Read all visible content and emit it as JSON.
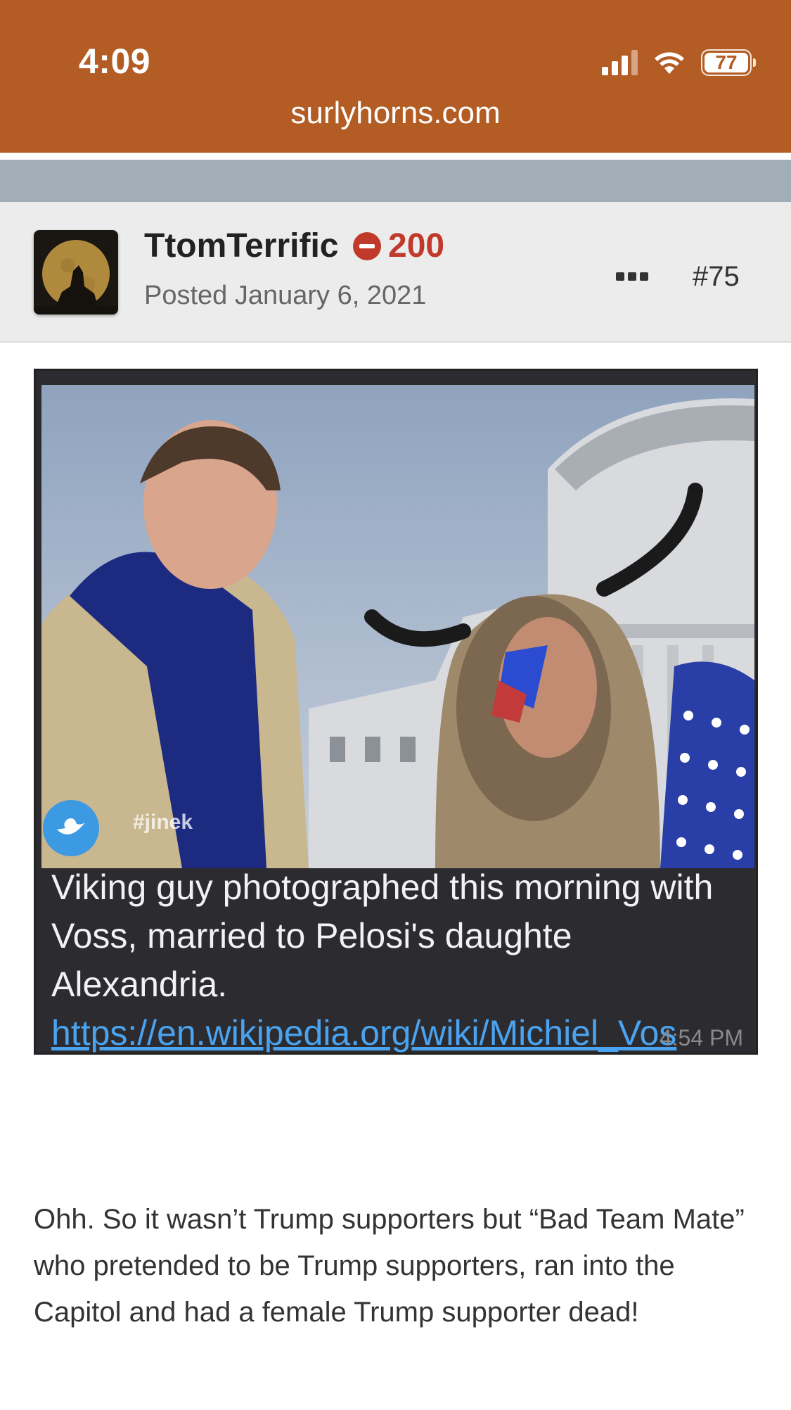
{
  "status_bar": {
    "time": "4:09",
    "battery": "77"
  },
  "browser": {
    "url": "surlyhorns.com"
  },
  "post": {
    "username": "TtomTerrific",
    "reputation": "200",
    "posted": "Posted January 6, 2021",
    "post_number": "#75",
    "embedded_image": {
      "watermark": "#jinek",
      "caption_text": "Viking guy photographed this morning with Voss, married to Pelosi's daughte Alexandria. ",
      "caption_link": "https://en.wikipedia.org/wiki/Michiel_Vos",
      "timestamp": "4:54 PM"
    },
    "body": "Ohh. So it wasn’t Trump supporters but “Bad Team Mate” who pretended to be Trump supporters, ran into the Capitol and had a female Trump supporter dead!"
  },
  "colors": {
    "header_bg": "#b35c23",
    "reputation_negative": "#c0392b",
    "link": "#4aa3f0"
  }
}
